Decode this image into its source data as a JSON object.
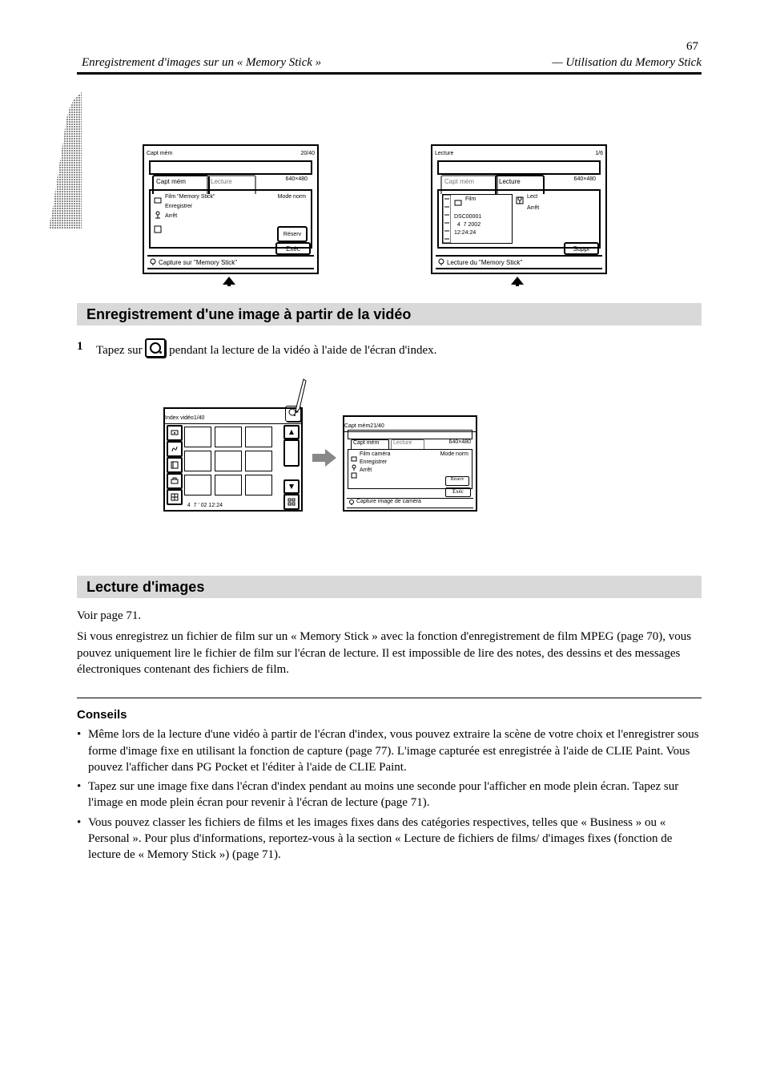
{
  "page_number": "67",
  "header_left": "Enregistrement d'images sur un « Memory Stick »",
  "header_right": "— Utilisation du Memory Stick",
  "lcd_left": {
    "title": "Capt mém",
    "capacity": "20/40",
    "tab1": "Capt mém",
    "tab2": "Lecture",
    "resolution": "640×480",
    "mode_label": "Mode norm",
    "row_film": "Film \"Memory Stick\"",
    "row_rec": "Enregistrer",
    "row_stop": "Arrêt",
    "hint_btn": "Exéc",
    "hint": "Capture sur \"Memory Stick\""
  },
  "lcd_right": {
    "title": "Lecture",
    "counter": "1/6",
    "tab1": "Capt mém",
    "tab2": "Lecture",
    "resolution": "640×480",
    "film_label": "Film",
    "sound_label": "",
    "box1": "Lect",
    "box2": "Arrêt",
    "name": "DSC00001",
    "date": "  4  7 2002",
    "time": "12:24:24",
    "hint_btn": "Suppr",
    "hint": "Lecture du \"Memory Stick\""
  },
  "section_record": {
    "title": "Enregistrement d'une image à partir de la vidéo",
    "step": "Tapez sur",
    "step_after": "pendant la lecture de la vidéo à l'aide de l'écran d'index.",
    "arrow_right_alt": "transition-arrow"
  },
  "grid_left": {
    "title": "Index vidéo",
    "counter": "1/40",
    "timestamp": "  4  7 ' 02 12:24"
  },
  "grid_right": {
    "title": "Capt mém",
    "counter": "21/40",
    "tab1": "Capt mém",
    "tab2": "Lecture",
    "resolution": "640×480",
    "mode": "Mode norm",
    "row_film": "Film caméra",
    "row_rec": "Enregistrer",
    "row_stop": "Arrêt",
    "hint_btn": "Exéc",
    "hint": "Capture image de caméra"
  },
  "section_play": {
    "title": "Lecture d'images",
    "body1": "Voir page 71.",
    "body2": "Si vous enregistrez un fichier de film sur un « Memory Stick » avec la fonction d'enregistrement de film MPEG (page 70), vous pouvez uniquement lire le fichier de film sur l'écran de lecture. Il est impossible de lire des notes, des dessins et des messages électroniques contenant des fichiers de film."
  },
  "tips": {
    "heading": "Conseils",
    "t1": "Même lors de la lecture d'une vidéo à partir de l'écran d'index, vous pouvez extraire la scène de votre choix et l'enregistrer sous forme d'image fixe en utilisant la fonction de capture (page 77). L'image capturée est enregistrée à l'aide de CLIE Paint. Vous pouvez l'afficher dans PG Pocket et l'éditer à l'aide de CLIE Paint.",
    "t2": "Tapez sur une image fixe dans l'écran d'index pendant au moins une seconde pour l'afficher en mode plein écran. Tapez sur l'image en mode plein écran pour revenir à l'écran de lecture (page 71).",
    "t3": "Vous pouvez classer les fichiers de films et les images fixes dans des catégories respectives, telles que « Business » ou « Personal ». Pour plus d'informations, reportez-vous à la section « Lecture de fichiers de films/ d'images fixes (fonction de lecture de « Memory Stick ») (page 71)."
  }
}
